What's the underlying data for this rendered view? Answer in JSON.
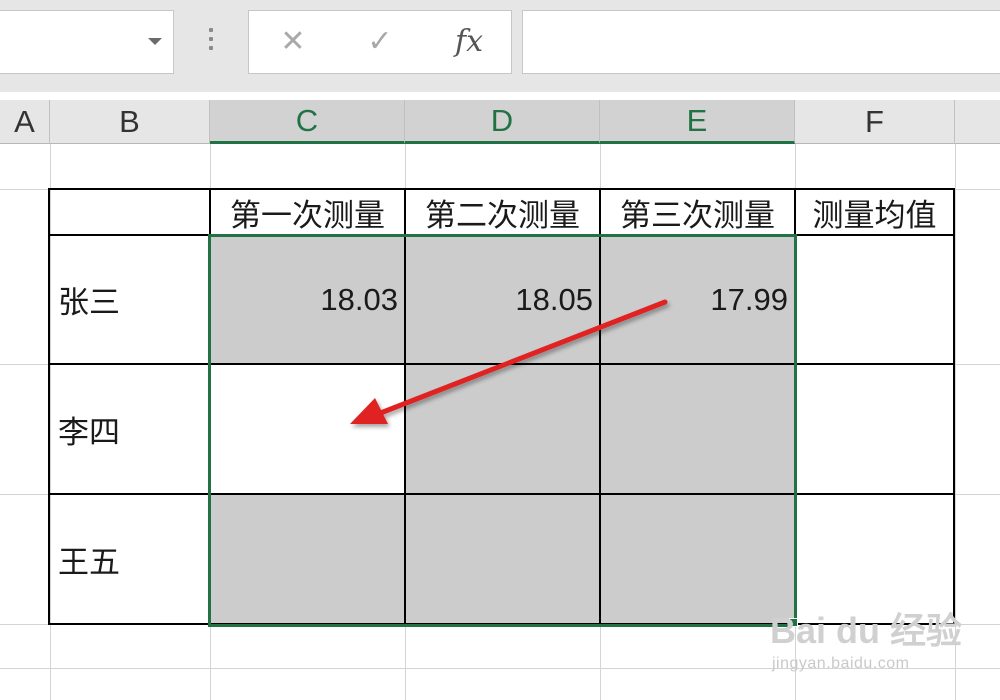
{
  "formula_bar": {
    "name_box_value": "",
    "cancel_glyph": "✕",
    "enter_glyph": "✓",
    "fx_label": "fx",
    "formula_value": ""
  },
  "columns": [
    "A",
    "B",
    "C",
    "D",
    "E",
    "F"
  ],
  "selected_columns": [
    "C",
    "D",
    "E"
  ],
  "table": {
    "headers": [
      "第一次测量",
      "第二次测量",
      "第三次测量",
      "测量均值"
    ],
    "rows": [
      {
        "name": "张三",
        "values": [
          "18.03",
          "18.05",
          "17.99"
        ],
        "avg": ""
      },
      {
        "name": "李四",
        "values": [
          "",
          "",
          ""
        ],
        "avg": ""
      },
      {
        "name": "王五",
        "values": [
          "",
          "",
          ""
        ],
        "avg": ""
      }
    ]
  },
  "colors": {
    "selection": "#217346",
    "fill_grey": "#cccccc",
    "arrow": "#e02020"
  },
  "watermark": {
    "logo": "Bai du 经验",
    "url": "jingyan.baidu.com"
  }
}
